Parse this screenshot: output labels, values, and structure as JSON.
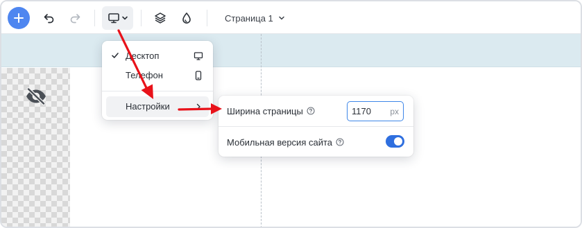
{
  "toolbar": {
    "page_select_label": "Страница 1",
    "icons": {
      "add": "plus-icon",
      "undo": "undo-icon",
      "redo": "redo-icon",
      "device": "monitor-icon",
      "device_caret": "chevron-down-icon",
      "layers": "layers-icon",
      "style": "drop-icon",
      "page_caret": "chevron-down-icon"
    }
  },
  "device_menu": {
    "items": [
      {
        "label": "Десктоп",
        "checked": true,
        "icon": "monitor-icon"
      },
      {
        "label": "Телефон",
        "checked": false,
        "icon": "phone-icon"
      },
      {
        "label": "Настройки",
        "submenu": true,
        "icon": "chevron-right-icon"
      }
    ]
  },
  "settings_panel": {
    "page_width_label": "Ширина страницы",
    "page_width_value": "1170",
    "page_width_unit": "px",
    "mobile_version_label": "Мобильная версия сайта",
    "mobile_version_enabled": true
  },
  "colors": {
    "accent": "#4e86f0",
    "toggle_on": "#2f6fdf",
    "annotation_arrow": "#e8121a",
    "header_band": "#dbeaf0"
  }
}
